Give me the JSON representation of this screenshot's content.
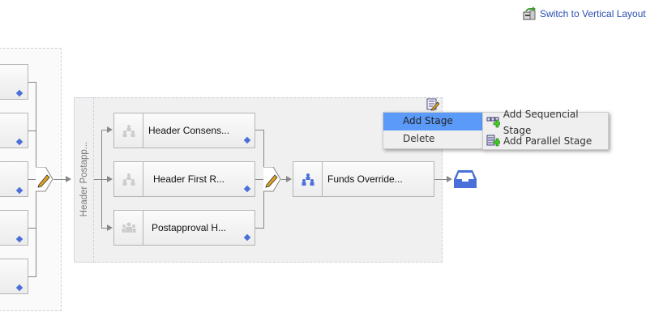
{
  "header": {
    "switch_layout_label": "Switch to Vertical Layout",
    "switch_layout_icon": "layout-switch-icon"
  },
  "left_stage": {
    "boxes": [
      "",
      "",
      "",
      "",
      ""
    ]
  },
  "stage": {
    "title": "Header Postapp...",
    "boxes": [
      {
        "label": "Header Consens...",
        "icon": "group-icon"
      },
      {
        "label": "Header First R...",
        "icon": "group-icon"
      },
      {
        "label": "Postapproval H...",
        "icon": "people-icon"
      }
    ]
  },
  "next_stage": {
    "label": "Funds Override...",
    "icon": "group-icon"
  },
  "context_menu": {
    "items": [
      "Add Stage",
      "Delete"
    ]
  },
  "submenu": {
    "items": [
      "Add Sequencial Stage",
      "Add Parallel Stage"
    ]
  },
  "colors": {
    "accent": "#4a6fd8",
    "menu_highlight": "#5b9af8",
    "link": "#2a4fb0"
  }
}
